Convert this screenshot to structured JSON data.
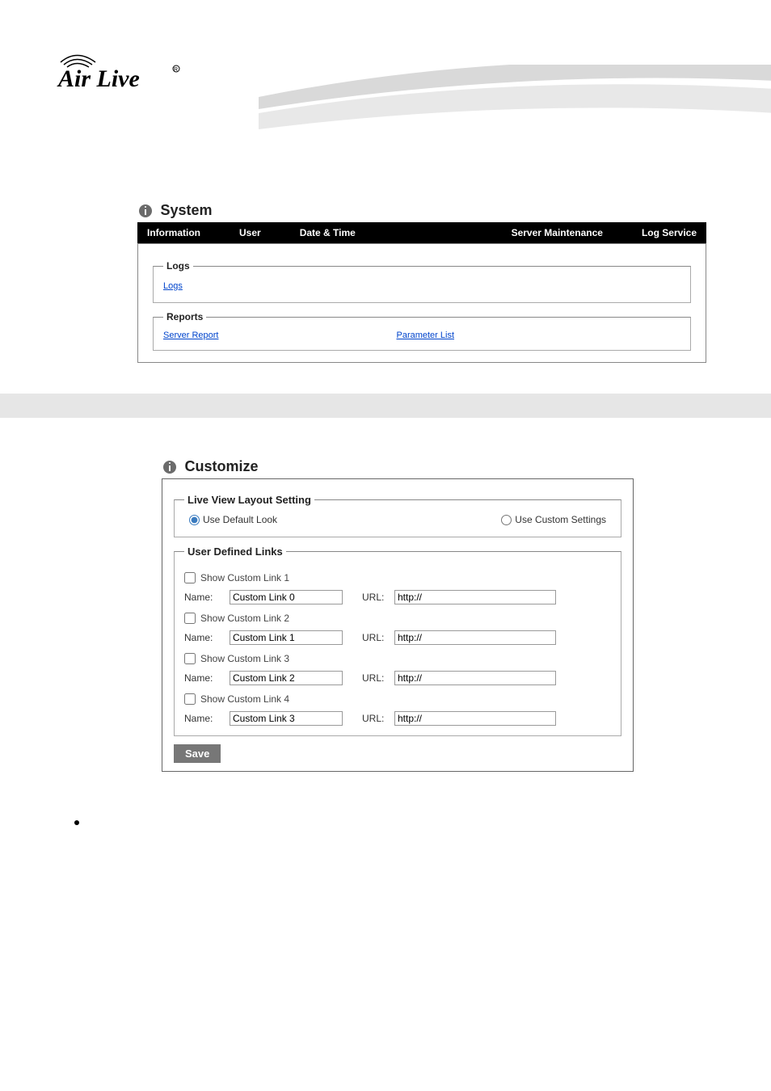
{
  "logo": {
    "text": "Air Live"
  },
  "system": {
    "title": "System",
    "tabs": [
      "Information",
      "User",
      "Date & Time",
      "Server Maintenance",
      "Log Service"
    ],
    "logs": {
      "legend": "Logs",
      "link": "Logs"
    },
    "reports": {
      "legend": "Reports",
      "serverReport": "Server Report",
      "parameterList": "Parameter List"
    }
  },
  "customize": {
    "title": "Customize",
    "liveView": {
      "legend": "Live View Layout Setting",
      "useDefault": "Use Default Look",
      "useCustom": "Use Custom Settings"
    },
    "userLinks": {
      "legend": "User Defined Links",
      "items": [
        {
          "showLabel": "Show Custom Link  1",
          "nameLabel": "Name:",
          "nameValue": "Custom Link 0",
          "urlLabel": "URL:",
          "urlValue": "http://"
        },
        {
          "showLabel": "Show Custom Link  2",
          "nameLabel": "Name:",
          "nameValue": "Custom Link 1",
          "urlLabel": "URL:",
          "urlValue": "http://"
        },
        {
          "showLabel": "Show Custom Link  3",
          "nameLabel": "Name:",
          "nameValue": "Custom Link 2",
          "urlLabel": "URL:",
          "urlValue": "http://"
        },
        {
          "showLabel": "Show Custom Link  4",
          "nameLabel": "Name:",
          "nameValue": "Custom Link 3",
          "urlLabel": "URL:",
          "urlValue": "http://"
        }
      ]
    },
    "saveLabel": "Save"
  }
}
